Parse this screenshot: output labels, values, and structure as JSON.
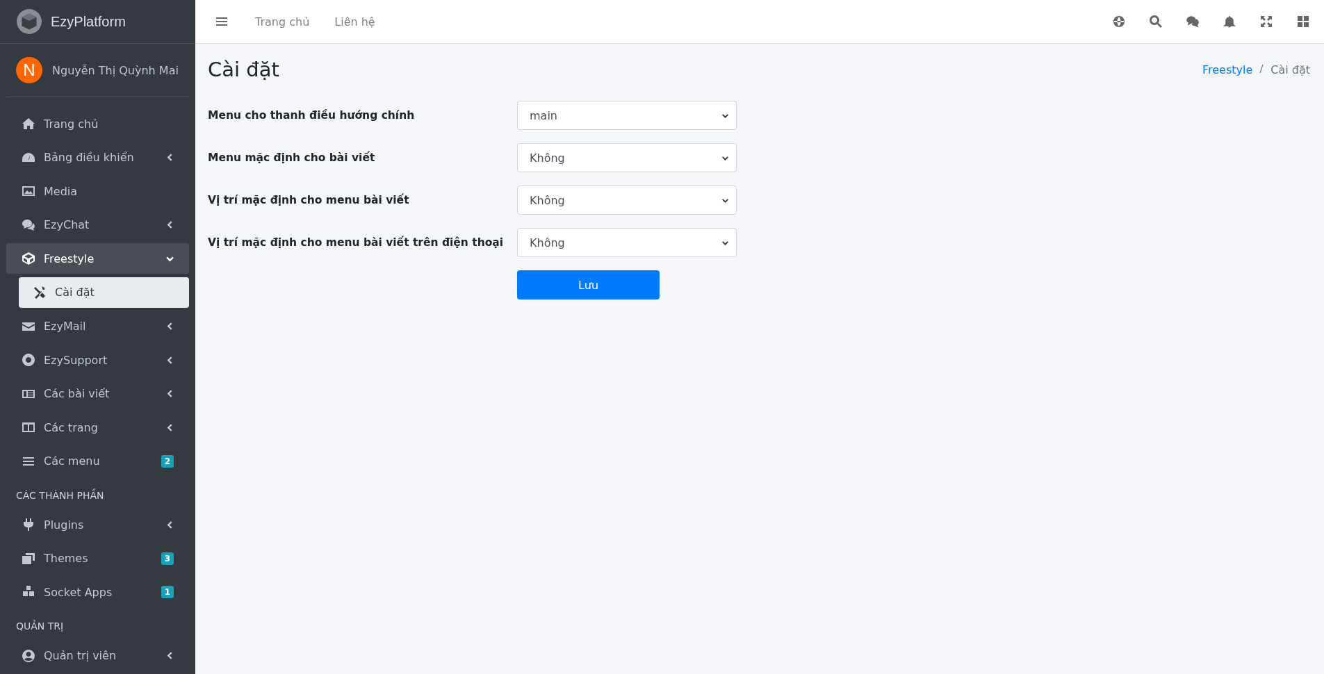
{
  "brand": {
    "name": "EzyPlatform"
  },
  "user": {
    "initial": "N",
    "name": "Nguyễn Thị Quỳnh Mai"
  },
  "sidebar": {
    "sections": [
      {
        "items": [
          {
            "label": "Trang chủ",
            "expandable": false,
            "expanded": false,
            "selected": false
          },
          {
            "label": "Bảng điều khiển",
            "expandable": true,
            "expanded": false,
            "selected": false
          },
          {
            "label": "Media",
            "expandable": false,
            "expanded": false,
            "selected": false
          },
          {
            "label": "EzyChat",
            "expandable": true,
            "expanded": false,
            "selected": false
          },
          {
            "label": "Freestyle",
            "expandable": true,
            "expanded": true,
            "selected": false,
            "children": [
              {
                "label": "Cài đặt",
                "selected": true
              }
            ]
          },
          {
            "label": "EzyMail",
            "expandable": true,
            "expanded": false,
            "selected": false
          },
          {
            "label": "EzySupport",
            "expandable": true,
            "expanded": false,
            "selected": false
          },
          {
            "label": "Các bài viết",
            "expandable": true,
            "expanded": false,
            "selected": false
          },
          {
            "label": "Các trang",
            "expandable": true,
            "expanded": false,
            "selected": false
          },
          {
            "label": "Các menu",
            "expandable": false,
            "expanded": false,
            "selected": false,
            "badge": "2"
          }
        ]
      },
      {
        "header": "CÁC THÀNH PHẦN",
        "items": [
          {
            "label": "Plugins",
            "expandable": true,
            "expanded": false,
            "selected": false
          },
          {
            "label": "Themes",
            "expandable": false,
            "expanded": false,
            "selected": false,
            "badge": "3"
          },
          {
            "label": "Socket Apps",
            "expandable": false,
            "expanded": false,
            "selected": false,
            "badge": "1"
          }
        ]
      },
      {
        "header": "QUẢN TRỊ",
        "items": [
          {
            "label": "Quản trị viên",
            "expandable": true,
            "expanded": false,
            "selected": false
          }
        ]
      }
    ]
  },
  "topbar": {
    "links": [
      "Trang chủ",
      "Liên hệ"
    ]
  },
  "page": {
    "title": "Cài đặt",
    "breadcrumb": [
      {
        "label": "Freestyle",
        "link": true
      },
      {
        "label": "Cài đặt",
        "link": false
      }
    ]
  },
  "form": {
    "fields": [
      {
        "label": "Menu cho thanh điều hướng chính",
        "value": "main"
      },
      {
        "label": "Menu mặc định cho bài viết",
        "value": "Không"
      },
      {
        "label": "Vị trí mặc định cho menu bài viết",
        "value": "Không"
      },
      {
        "label": "Vị trí mặc định cho menu bài viết trên điện thoại",
        "value": "Không"
      }
    ],
    "submit": "Lưu"
  }
}
